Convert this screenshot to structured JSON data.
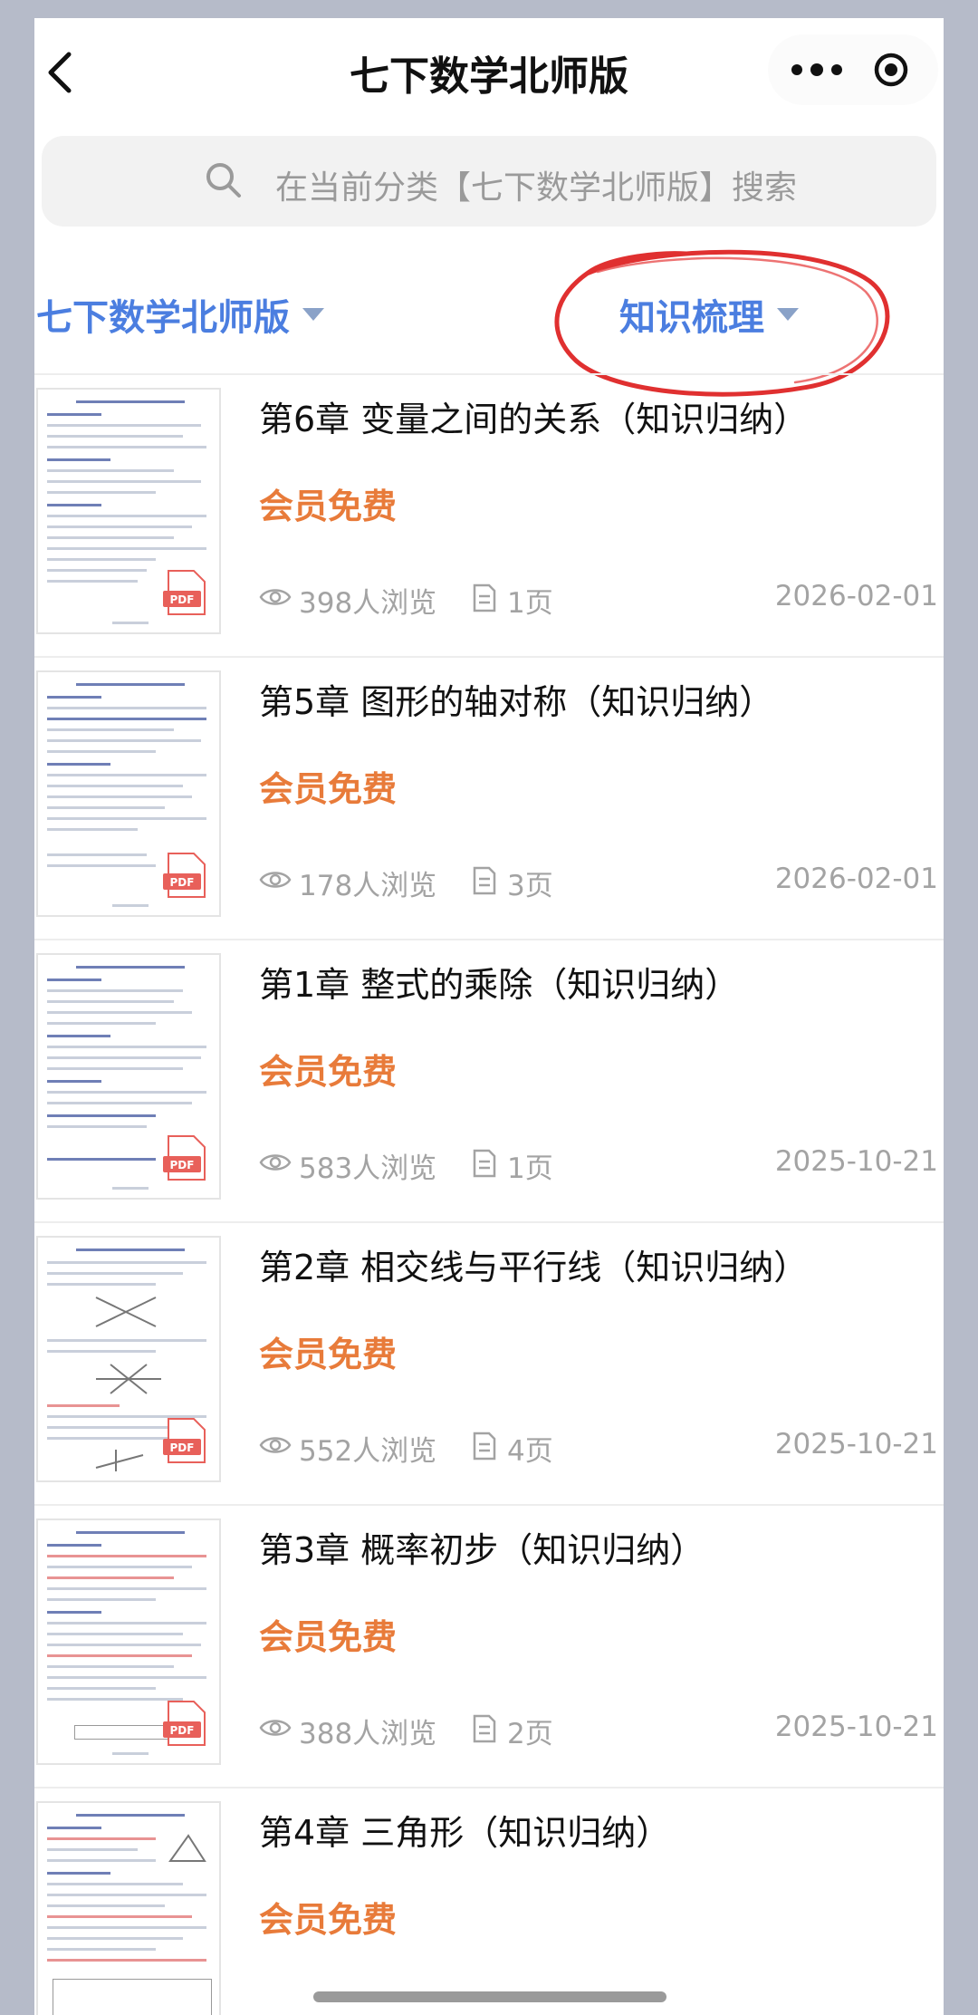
{
  "nav": {
    "title": "七下数学北师版"
  },
  "search": {
    "placeholder": "在当前分类【七下数学北师版】搜索"
  },
  "filters": [
    {
      "label": "七下数学北师版"
    },
    {
      "label": "知识梳理"
    }
  ],
  "items": [
    {
      "title": "第6章 变量之间的关系（知识归纳）",
      "price": "会员免费",
      "views": "398人浏览",
      "pages": "1页",
      "date": "2026-02-01",
      "thumb_badge": "PDF"
    },
    {
      "title": "第5章 图形的轴对称（知识归纳）",
      "price": "会员免费",
      "views": "178人浏览",
      "pages": "3页",
      "date": "2026-02-01",
      "thumb_badge": "PDF"
    },
    {
      "title": "第1章 整式的乘除（知识归纳）",
      "price": "会员免费",
      "views": "583人浏览",
      "pages": "1页",
      "date": "2025-10-21",
      "thumb_badge": "PDF"
    },
    {
      "title": "第2章 相交线与平行线（知识归纳）",
      "price": "会员免费",
      "views": "552人浏览",
      "pages": "4页",
      "date": "2025-10-21",
      "thumb_badge": "PDF"
    },
    {
      "title": "第3章 概率初步（知识归纳）",
      "price": "会员免费",
      "views": "388人浏览",
      "pages": "2页",
      "date": "2025-10-21",
      "thumb_badge": "PDF"
    },
    {
      "title": "第4章 三角形（知识归纳）",
      "price": "会员免费",
      "views": "",
      "pages": "",
      "date": "",
      "thumb_badge": ""
    }
  ],
  "colors": {
    "accent": "#4b7ee0",
    "price": "#e87b3a",
    "annotation": "#e03030"
  }
}
